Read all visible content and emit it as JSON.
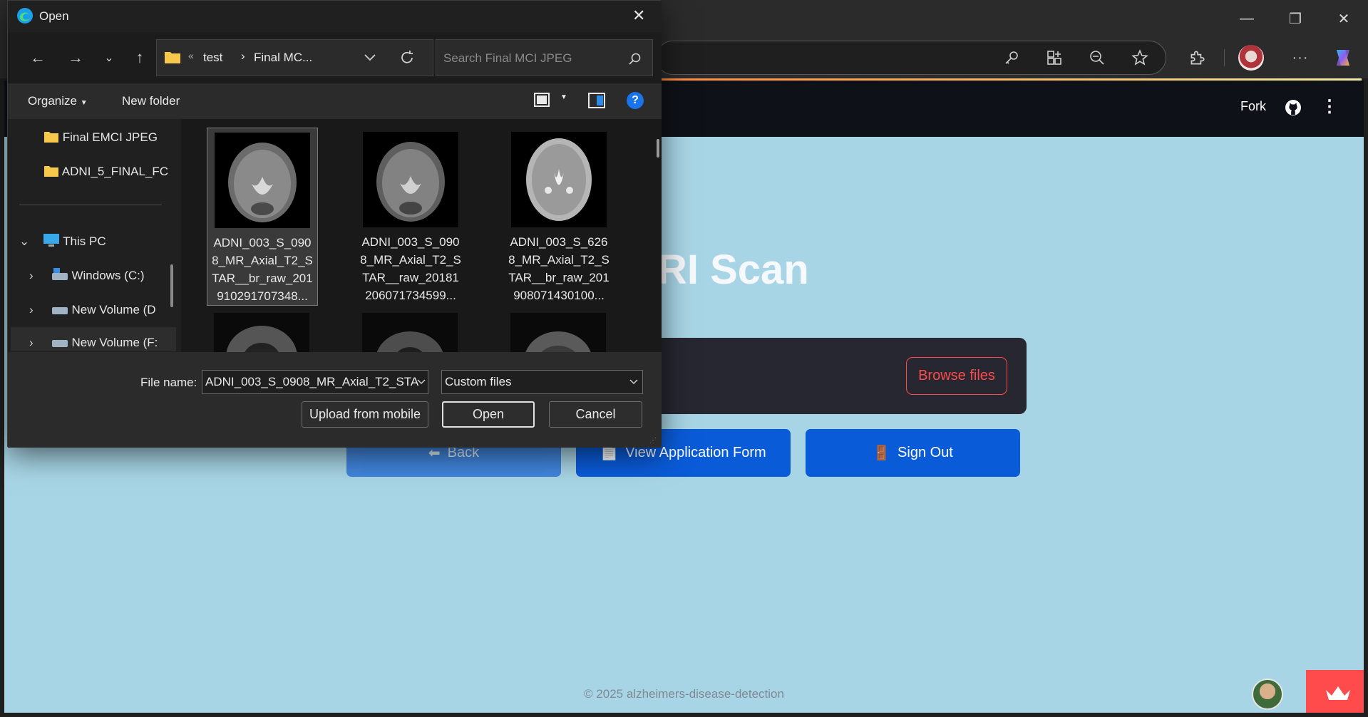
{
  "browser": {
    "window_controls": {
      "minimize": "—",
      "restore": "❐",
      "close": "✕"
    },
    "toolbar_icons": [
      "key-icon",
      "apps-icon",
      "zoom-out-icon",
      "favorite-star-icon",
      "extensions-icon",
      "profile-avatar",
      "more-icon",
      "copilot-icon"
    ],
    "more_glyph": "···"
  },
  "app": {
    "header": {
      "fork_label": "Fork",
      "menu_glyph": "⋮"
    },
    "title_visible": "RI Scan",
    "browse_label": "Browse files",
    "buttons": {
      "back": {
        "icon": "⬅",
        "label": "Back"
      },
      "view_form": {
        "icon": "📄",
        "label": "View Application Form"
      },
      "sign_out": {
        "icon": "🚪",
        "label": "Sign Out"
      }
    },
    "footer": "© 2025 alzheimers-disease-detection"
  },
  "dialog": {
    "title": "Open",
    "breadcrumb": {
      "overflow": "«",
      "items": [
        "test",
        "Final MC..."
      ]
    },
    "search_placeholder": "Search Final MCI JPEG",
    "commands": {
      "organize": "Organize",
      "new_folder": "New folder",
      "help": "?"
    },
    "nav_tree": [
      {
        "label": "Final EMCI JPEG",
        "icon": "folder-icon"
      },
      {
        "label": "ADNI_5_FINAL_FC",
        "icon": "folder-icon"
      },
      {
        "label": "This PC",
        "icon": "computer-icon",
        "expanded": true
      },
      {
        "label": "Windows (C:)",
        "icon": "drive-icon"
      },
      {
        "label": "New Volume (D",
        "icon": "drive-icon"
      },
      {
        "label": "New Volume (F:",
        "icon": "drive-icon"
      }
    ],
    "files": [
      {
        "lines": [
          "ADNI_003_S_090",
          "8_MR_Axial_T2_S",
          "TAR__br_raw_201",
          "910291707348..."
        ],
        "selected": true
      },
      {
        "lines": [
          "ADNI_003_S_090",
          "8_MR_Axial_T2_S",
          "TAR__raw_20181",
          "206071734599..."
        ],
        "selected": false
      },
      {
        "lines": [
          "ADNI_003_S_626",
          "8_MR_Axial_T2_S",
          "TAR__br_raw_201",
          "908071430100..."
        ],
        "selected": false
      }
    ],
    "file_name_label": "File name:",
    "file_name_value": "ADNI_003_S_0908_MR_Axial_T2_STA",
    "file_type": "Custom files",
    "upload_mobile": "Upload from mobile",
    "open": "Open",
    "cancel": "Cancel"
  }
}
